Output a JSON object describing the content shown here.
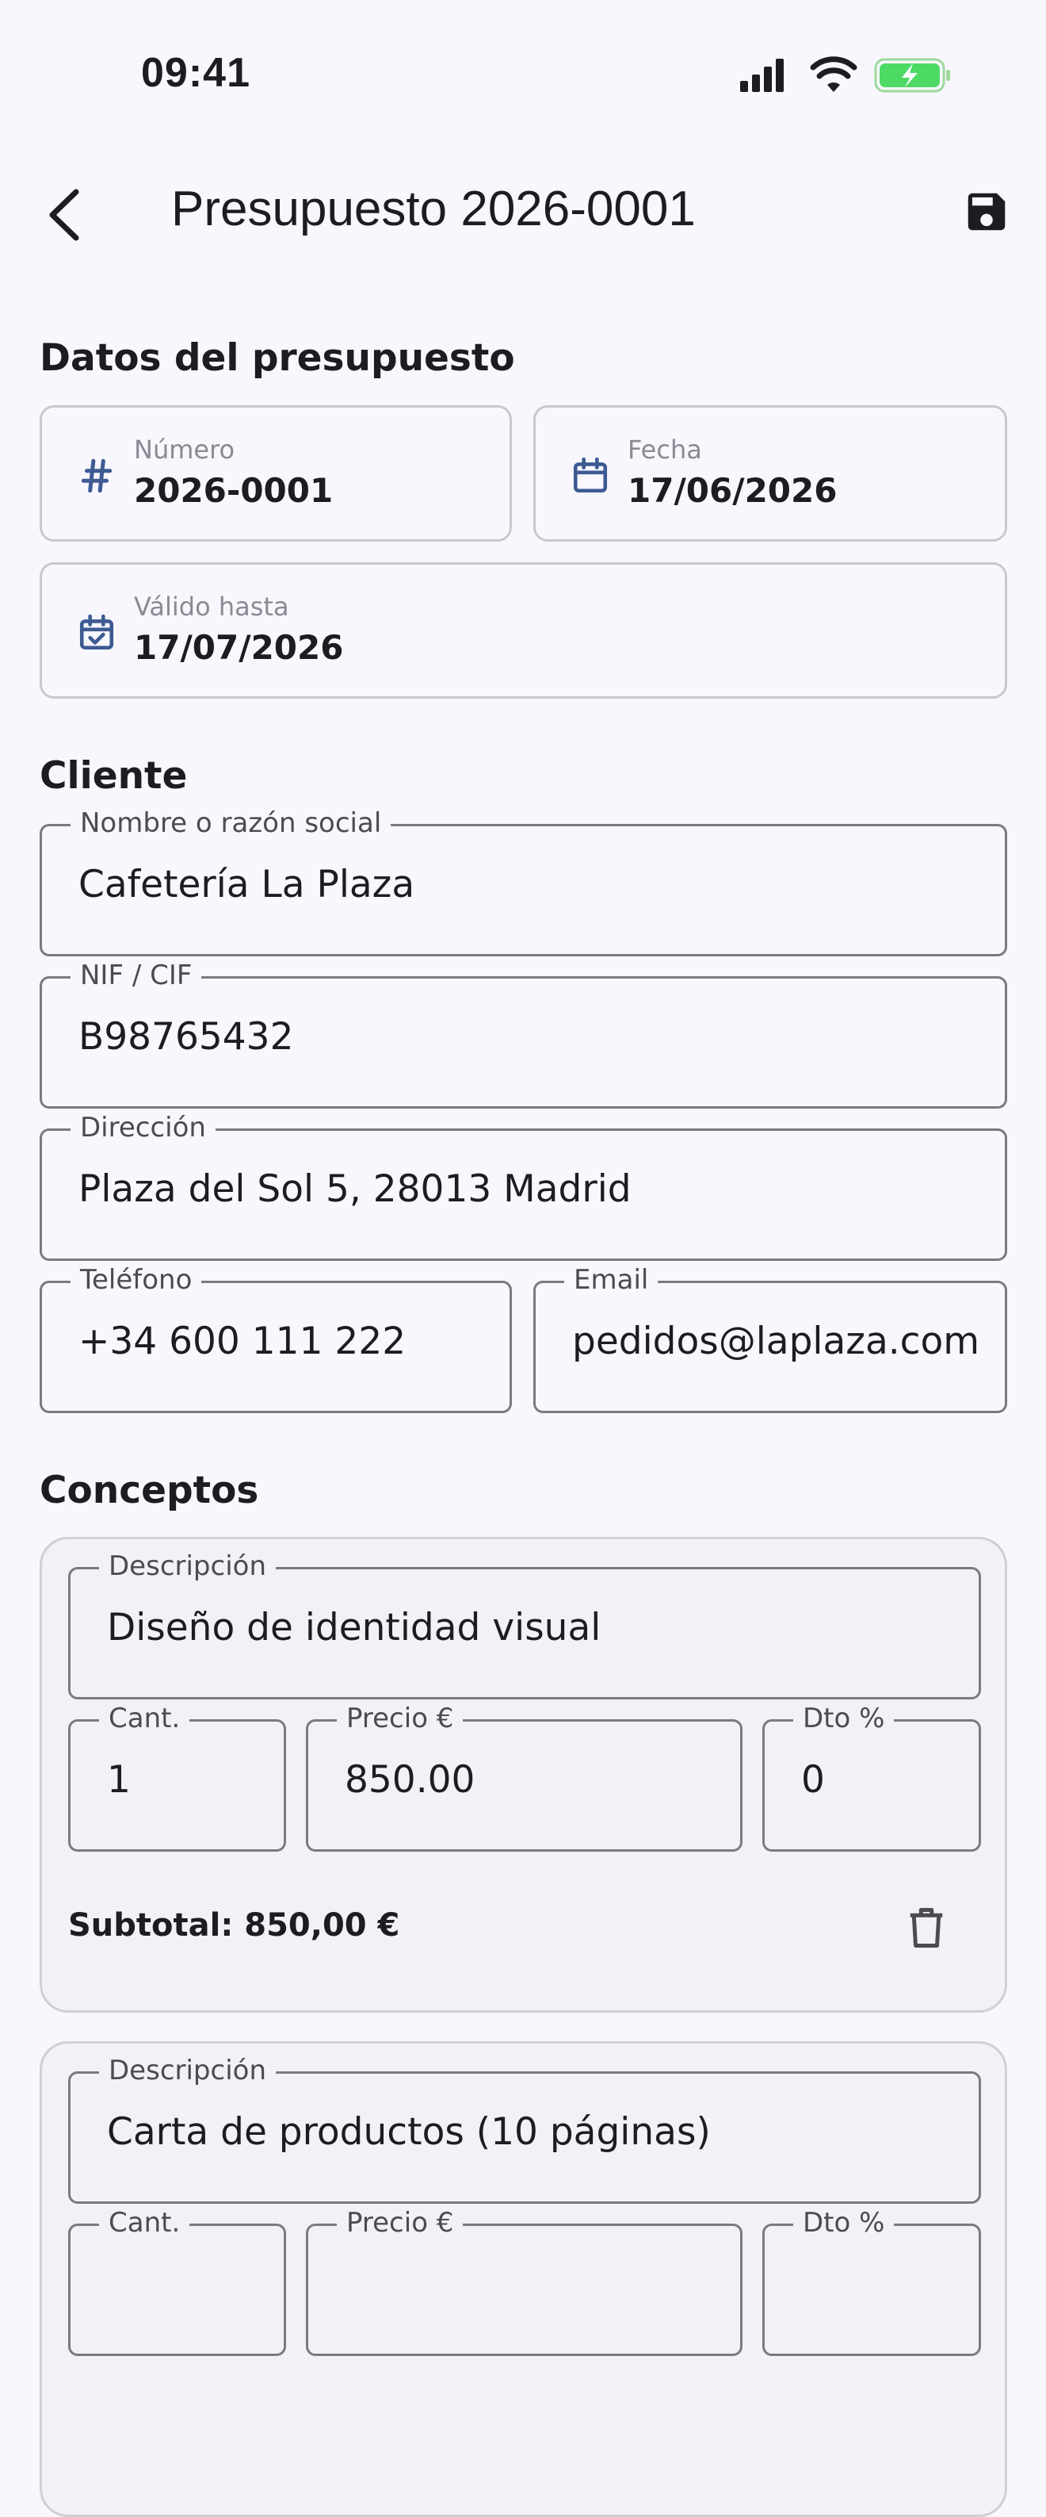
{
  "status_bar": {
    "time": "09:41"
  },
  "app_bar": {
    "title": "Presupuesto 2026-0001"
  },
  "budget_data": {
    "section_title": "Datos del presupuesto",
    "number": {
      "label": "Número",
      "value": "2026-0001"
    },
    "date": {
      "label": "Fecha",
      "value": "17/06/2026"
    },
    "valid_until": {
      "label": "Válido hasta",
      "value": "17/07/2026"
    }
  },
  "client": {
    "section_title": "Cliente",
    "name": {
      "label": "Nombre o razón social",
      "value": "Cafetería La Plaza"
    },
    "nif": {
      "label": "NIF / CIF",
      "value": "B98765432"
    },
    "address": {
      "label": "Dirección",
      "value": "Plaza del Sol 5, 28013 Madrid"
    },
    "phone": {
      "label": "Teléfono",
      "value": "+34 600 111 222"
    },
    "email": {
      "label": "Email",
      "value": "pedidos@laplaza.com"
    }
  },
  "concepts": {
    "section_title": "Conceptos",
    "items": [
      {
        "description_label": "Descripción",
        "description": "Diseño de identidad visual",
        "qty_label": "Cant.",
        "qty": "1",
        "price_label": "Precio €",
        "price": "850.00",
        "discount_label": "Dto %",
        "discount": "0",
        "subtotal": "Subtotal: 850,00 €"
      },
      {
        "description_label": "Descripción",
        "description": "Carta de productos (10 páginas)",
        "qty_label": "Cant.",
        "price_label": "Precio €",
        "discount_label": "Dto %"
      }
    ]
  },
  "colors": {
    "accent": "#3d5a92",
    "background": "#f7f7fd",
    "battery": "#4cd964"
  }
}
